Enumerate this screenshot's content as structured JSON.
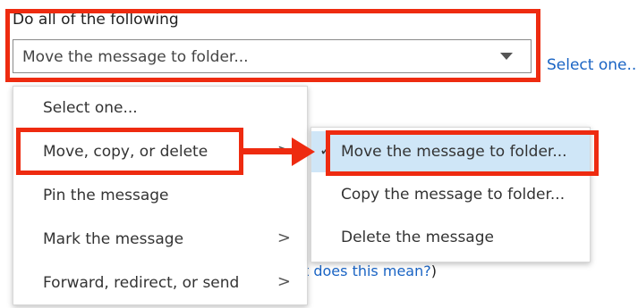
{
  "section": {
    "label": "Do all of the following"
  },
  "dropdown": {
    "value": "Move the message to folder..."
  },
  "links": {
    "select_one": "Select one...",
    "help_fragment": "t does this mean?",
    "help_paren": ")"
  },
  "menu": {
    "items": [
      {
        "label": "Select one...",
        "has_submenu": false
      },
      {
        "label": "Move, copy, or delete",
        "has_submenu": true,
        "chevron": ">"
      },
      {
        "label": "Pin the message",
        "has_submenu": false
      },
      {
        "label": "Mark the message",
        "has_submenu": true,
        "chevron": ">"
      },
      {
        "label": "Forward, redirect, or send",
        "has_submenu": true,
        "chevron": ">"
      }
    ]
  },
  "submenu": {
    "items": [
      {
        "label": "Move the message to folder...",
        "selected": true
      },
      {
        "label": "Copy the message to folder..."
      },
      {
        "label": "Delete the message"
      }
    ]
  },
  "annotations": {
    "highlight_color": "#ee2b10",
    "link_color": "#1a64c4",
    "selection_bg": "#cfe6f7"
  }
}
